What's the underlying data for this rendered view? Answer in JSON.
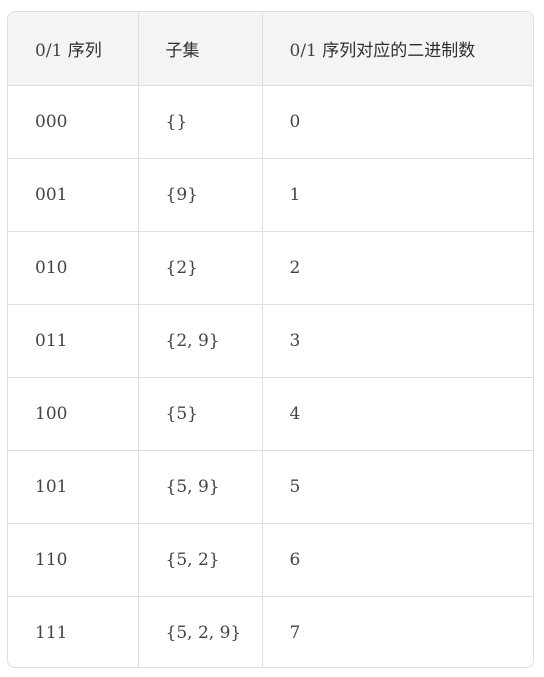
{
  "table": {
    "headers": [
      {
        "math": "0/1",
        "text": "序列"
      },
      {
        "math": "",
        "text": "子集"
      },
      {
        "math": "0/1",
        "text": "序列对应的二进制数"
      }
    ],
    "rows": [
      {
        "seq": "000",
        "subset": "{}",
        "num": "0"
      },
      {
        "seq": "001",
        "subset": "{9}",
        "num": "1"
      },
      {
        "seq": "010",
        "subset": "{2}",
        "num": "2"
      },
      {
        "seq": "011",
        "subset": "{2, 9}",
        "num": "3"
      },
      {
        "seq": "100",
        "subset": "{5}",
        "num": "4"
      },
      {
        "seq": "101",
        "subset": "{5, 9}",
        "num": "5"
      },
      {
        "seq": "110",
        "subset": "{5, 2}",
        "num": "6"
      },
      {
        "seq": "111",
        "subset": "{5, 2, 9}",
        "num": "7"
      }
    ]
  }
}
